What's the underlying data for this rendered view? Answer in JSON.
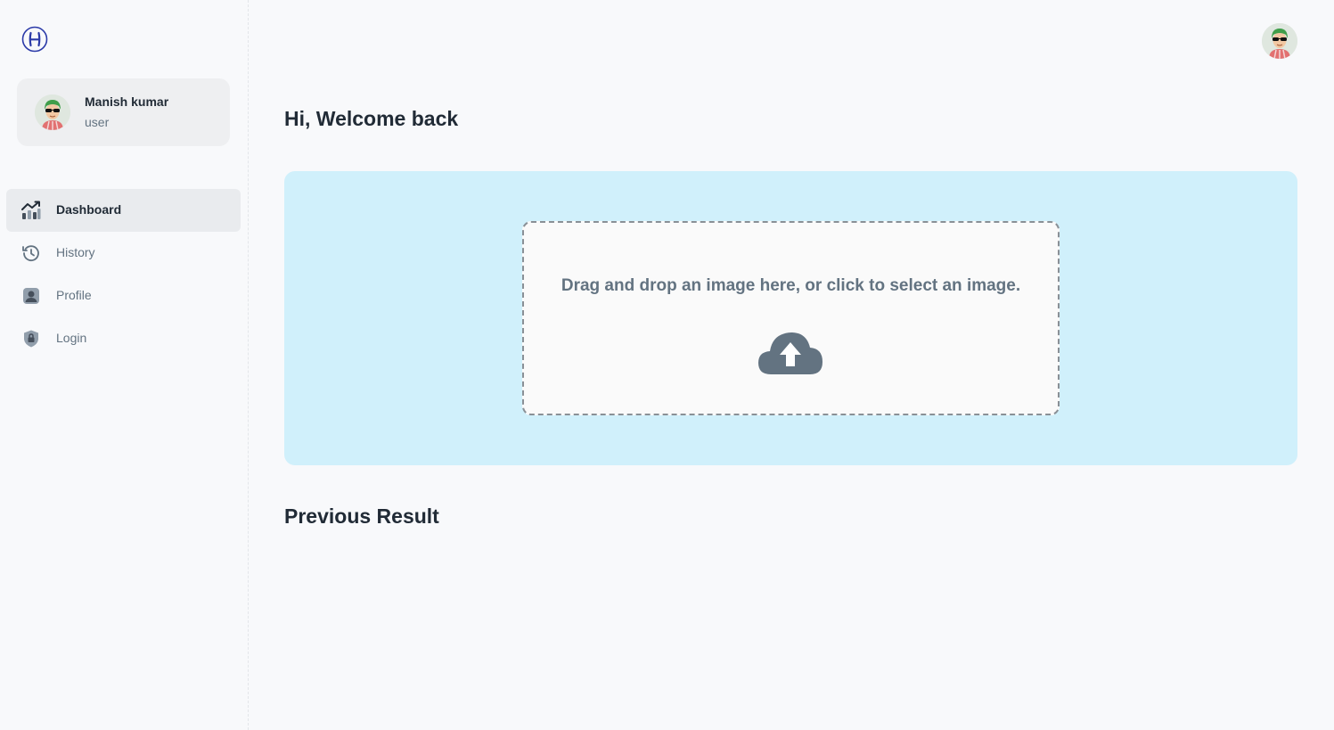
{
  "sidebar": {
    "logo_icon": "h-logo-icon",
    "account": {
      "name": "Manish kumar",
      "role": "user",
      "avatar_icon": "user-avatar"
    },
    "nav": [
      {
        "label": "Dashboard",
        "icon": "chart-trend-icon",
        "active": true
      },
      {
        "label": "History",
        "icon": "history-icon",
        "active": false
      },
      {
        "label": "Profile",
        "icon": "profile-icon",
        "active": false
      },
      {
        "label": "Login",
        "icon": "lock-shield-icon",
        "active": false
      }
    ]
  },
  "header": {
    "avatar_icon": "user-avatar"
  },
  "main": {
    "welcome": "Hi, Welcome back",
    "upload": {
      "text": "Drag and drop an image here, or click to select an image.",
      "icon": "cloud-upload-icon"
    },
    "previous_title": "Previous Result"
  },
  "colors": {
    "upload_panel_bg": "#d0f0fb",
    "active_nav_bg": "#e9ebee",
    "text_primary": "#212b36",
    "text_secondary": "#637381"
  }
}
